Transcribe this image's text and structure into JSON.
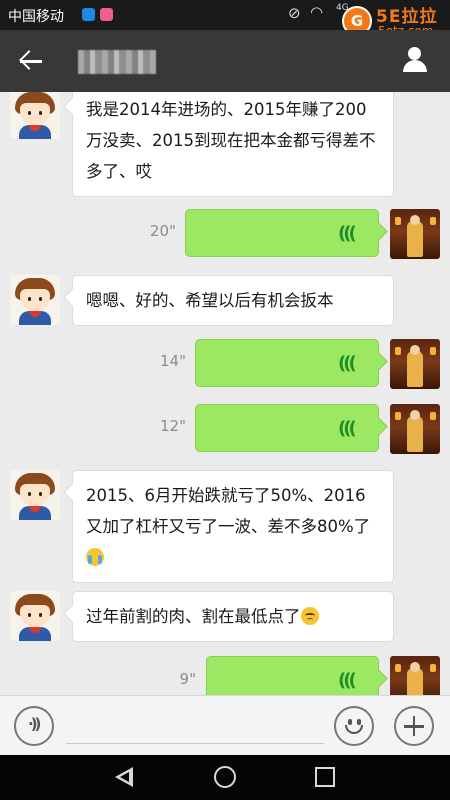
{
  "status_bar": {
    "carrier": "中国移动",
    "network": "4G"
  },
  "watermark": {
    "badge": "G",
    "title": "5E拉拉",
    "url": "5etz.com"
  },
  "header": {
    "back_icon": "arrow-left-icon",
    "profile_icon": "person-icon",
    "title_blurred": true
  },
  "messages": [
    {
      "from": "other",
      "type": "text",
      "text": "我是2014年进场的、2015年赚了200万没卖、2015到现在把本金都亏得差不多了、哎"
    },
    {
      "from": "me",
      "type": "voice",
      "duration": "20\""
    },
    {
      "from": "other",
      "type": "text",
      "text": "嗯嗯、好的、希望以后有机会扳本"
    },
    {
      "from": "me",
      "type": "voice",
      "duration": "14\""
    },
    {
      "from": "me",
      "type": "voice",
      "duration": "12\""
    },
    {
      "from": "other",
      "type": "text",
      "text": "2015、6月开始跌就亏了50%、2016又加了杠杆又亏了一波、差不多80%了",
      "emoji": "crying-face"
    },
    {
      "from": "other",
      "type": "text",
      "text": "过年前割的肉、割在最低点了",
      "emoji": "sad-face"
    },
    {
      "from": "me",
      "type": "voice",
      "duration": "9\""
    }
  ],
  "input_bar": {
    "voice_icon": "voice-input-icon",
    "emoji_icon": "smiley-icon",
    "more_icon": "plus-icon",
    "text_value": ""
  },
  "colors": {
    "header_bg": "#383838",
    "chat_bg": "#ebebeb",
    "voice_bubble": "#9de862",
    "watermark": "#f07a1a"
  }
}
